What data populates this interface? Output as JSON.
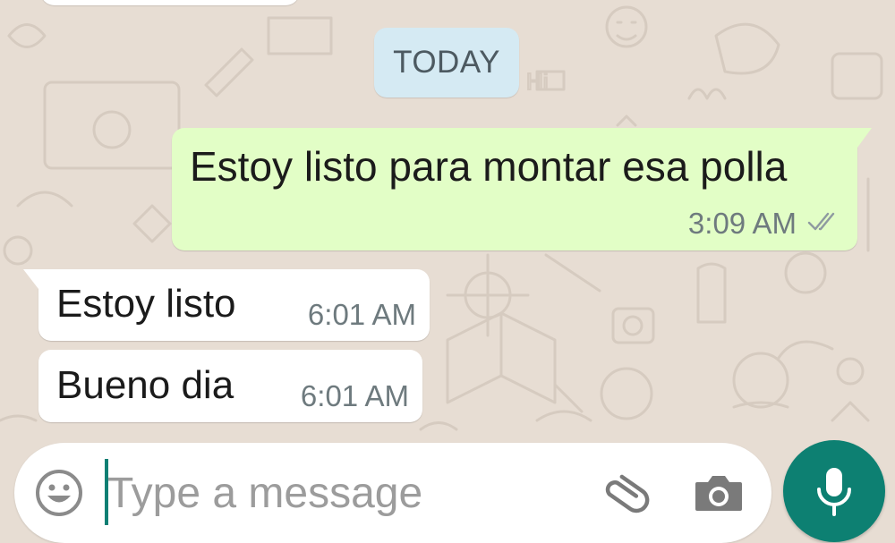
{
  "date_separator": "TODAY",
  "messages": [
    {
      "direction": "outgoing",
      "text": "Estoy listo para montar esa polla",
      "time": "3:09 AM",
      "status": "read-double-check-icon"
    },
    {
      "direction": "incoming",
      "text": "Estoy listo",
      "time": "6:01 AM"
    },
    {
      "direction": "incoming",
      "text": "Bueno dia",
      "time": "6:01 AM"
    }
  ],
  "composer": {
    "placeholder": "Type a message",
    "value": "",
    "icons": [
      "emoji-icon",
      "attach-icon",
      "camera-icon",
      "mic-icon"
    ]
  },
  "colors": {
    "wallpaper": "#e7ddd3",
    "outgoing_bubble": "#e2fec6",
    "incoming_bubble": "#ffffff",
    "date_chip": "#d5eaf3",
    "accent": "#0d8072",
    "read_ticks": "#8e9aa0"
  }
}
